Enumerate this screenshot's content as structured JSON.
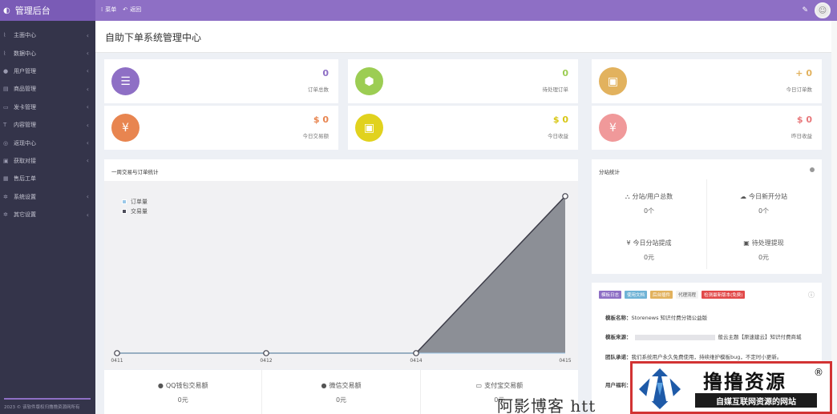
{
  "topbar": {
    "brand": "管理后台",
    "nav": [
      {
        "icon": "menu-icon",
        "label": "菜单"
      },
      {
        "icon": "back-arrow-icon",
        "label": "返回"
      }
    ]
  },
  "sidebar": {
    "items": [
      {
        "icon": "line-chart-icon",
        "label": "主面中心"
      },
      {
        "icon": "area-chart-icon",
        "label": "数据中心"
      },
      {
        "icon": "user-icon",
        "label": "用户管理"
      },
      {
        "icon": "cart-icon",
        "label": "商品管理"
      },
      {
        "icon": "card-icon",
        "label": "发卡管理"
      },
      {
        "icon": "content-icon",
        "label": "内容管理"
      },
      {
        "icon": "target-icon",
        "label": "返现中心"
      },
      {
        "icon": "gift-icon",
        "label": "获取对接"
      },
      {
        "icon": "ticket-icon",
        "label": "售后工单"
      },
      {
        "icon": "gear-icon",
        "label": "系统设置"
      },
      {
        "icon": "cog-icon",
        "label": "其它设置"
      }
    ],
    "footer": "2023 © 该软件版权归撸撸资源网所有"
  },
  "page": {
    "title": "自助下单系统管理中心"
  },
  "stats": [
    {
      "value": "0",
      "label": "订单总数",
      "color": "#8e6fc5",
      "value_color": "#8e6fc5",
      "icon": "list-icon"
    },
    {
      "value": "0",
      "label": "待处理订单",
      "color": "#9ccd53",
      "value_color": "#9ccd53",
      "icon": "cube-icon"
    },
    {
      "value": "+ 0",
      "label": "今日订单数",
      "color": "#e2b25e",
      "value_color": "#e2b25e",
      "icon": "briefcase-icon"
    },
    {
      "value": "$ 0",
      "label": "今日交易额",
      "color": "#e88550",
      "value_color": "#e88550",
      "icon": "yen-icon"
    },
    {
      "value": "$ 0",
      "label": "今日收益",
      "color": "#e1d21e",
      "value_color": "#d8c716",
      "icon": "briefcase-icon"
    },
    {
      "value": "$ 0",
      "label": "昨日收益",
      "color": "#f0999a",
      "value_color": "#e8777a",
      "icon": "yen-icon"
    }
  ],
  "chart_panel": {
    "title": "一周交易与订单统计"
  },
  "chart_data": {
    "type": "area",
    "categories": [
      "0411",
      "0412",
      "0414",
      "0415"
    ],
    "series": [
      {
        "name": "订单量",
        "values": [
          0,
          0,
          0,
          0
        ],
        "color": "#9bc8e8"
      },
      {
        "name": "交易量",
        "values": [
          0,
          0,
          0,
          1
        ],
        "color": "#4d4d5a"
      }
    ]
  },
  "payments": [
    {
      "icon": "qq-icon",
      "label": "QQ钱包交易额",
      "value": "0元"
    },
    {
      "icon": "wechat-icon",
      "label": "微信交易额",
      "value": "0元"
    },
    {
      "icon": "alipay-icon",
      "label": "支付宝交易额",
      "value": "0元"
    }
  ],
  "sub_panel": {
    "title": "分站统计",
    "items": [
      {
        "icon": "sitemap-icon",
        "label": "分站/用户总数",
        "value": "0个"
      },
      {
        "icon": "cloud-icon",
        "label": "今日新开分站",
        "value": "0个"
      },
      {
        "icon": "yen-icon",
        "label": "今日分站提成",
        "value": "0元"
      },
      {
        "icon": "money-icon",
        "label": "待处理提现",
        "value": "0元"
      }
    ]
  },
  "info_panel": {
    "tags": [
      {
        "label": "模板日志",
        "color": "#8e6fc5"
      },
      {
        "label": "使用文档",
        "color": "#6fb3d6"
      },
      {
        "label": "后台插件",
        "color": "#e2b25e"
      },
      {
        "label": "代理流程",
        "color": "#f3f3f3",
        "text": "#555"
      },
      {
        "label": "检测最新版本(免费)",
        "color": "#e24a4a"
      }
    ],
    "lines": [
      {
        "label": "模板名称：",
        "text": "Storenews 知识付费分销公益版"
      },
      {
        "label": "模板来源：",
        "text": "般云主题【原速建云】知识付费商城"
      },
      {
        "label": "团队承诺：",
        "text": "我们系统用户永久免费使用，持续维护模板bug，不定时小更新。"
      },
      {
        "label": "用户福利：",
        "text": ""
      }
    ]
  },
  "watermark": {
    "text": "阿影博客 htt",
    "logo_title": "撸撸资源",
    "logo_sub": "自媒互联网资源的网站",
    "reg": "®"
  }
}
